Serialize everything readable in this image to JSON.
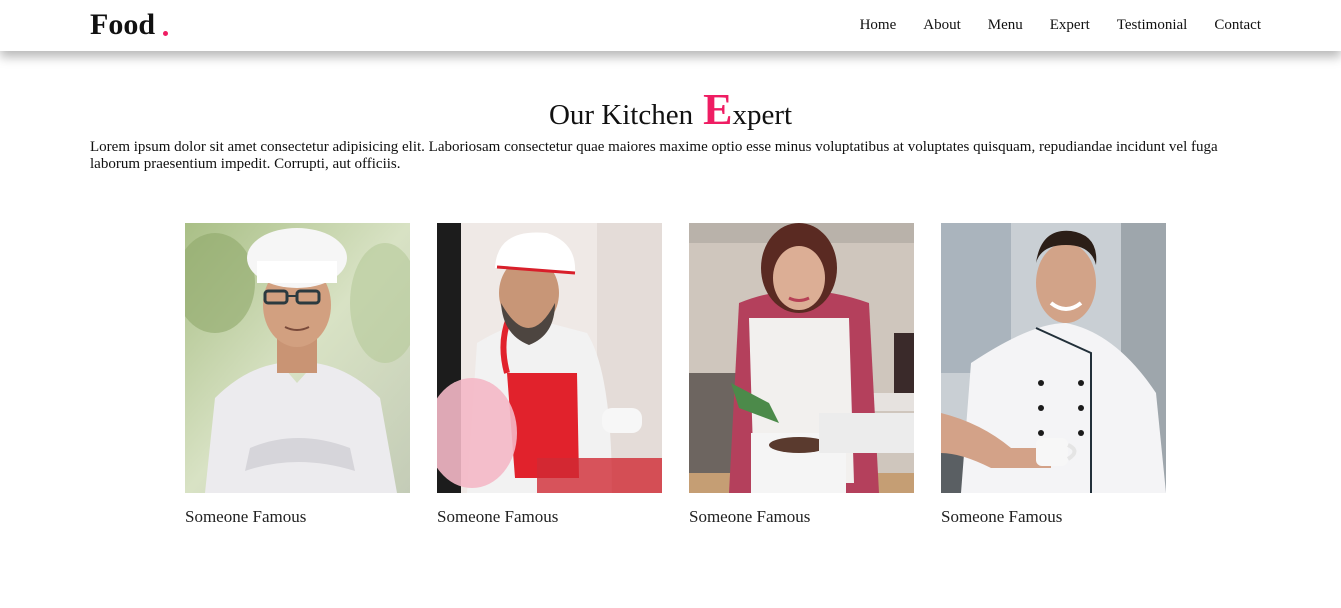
{
  "header": {
    "brand": "Food",
    "nav": [
      "Home",
      "About",
      "Menu",
      "Expert",
      "Testimonial",
      "Contact"
    ]
  },
  "section": {
    "title_prefix": "Our Kitchen",
    "title_accent_letter": "E",
    "title_rest": "xpert",
    "description": "Lorem ipsum dolor sit amet consectetur adipisicing elit. Laboriosam consectetur quae maiores maxime optio esse minus voluptatibus at voluptates quisquam, repudiandae incidunt vel fuga laborum praesentium impedit. Corrupti, aut officiis."
  },
  "experts": [
    {
      "name": "Someone Famous"
    },
    {
      "name": "Someone Famous"
    },
    {
      "name": "Someone Famous"
    },
    {
      "name": "Someone Famous"
    }
  ],
  "colors": {
    "accent": "#ef1d63",
    "text": "#111111",
    "background": "#ffffff"
  }
}
